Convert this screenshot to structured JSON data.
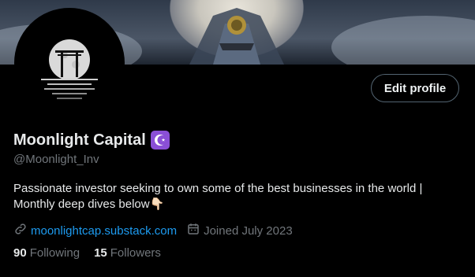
{
  "profile": {
    "display_name": "Moonlight Capital",
    "handle": "@Moonlight_Inv",
    "bio": "Passionate investor seeking to own some of the best businesses in the world | Monthly deep dives below👇🏻",
    "website": "moonlightcap.substack.com",
    "joined": "Joined July 2023",
    "badge_icon": "star-and-crescent-icon"
  },
  "actions": {
    "edit_profile_label": "Edit profile"
  },
  "stats": {
    "following_count": "90",
    "following_label": "Following",
    "followers_count": "15",
    "followers_label": "Followers"
  },
  "colors": {
    "background": "#000000",
    "link": "#1d9bf0",
    "muted": "#71767b",
    "badge": "#8a4fd6"
  }
}
